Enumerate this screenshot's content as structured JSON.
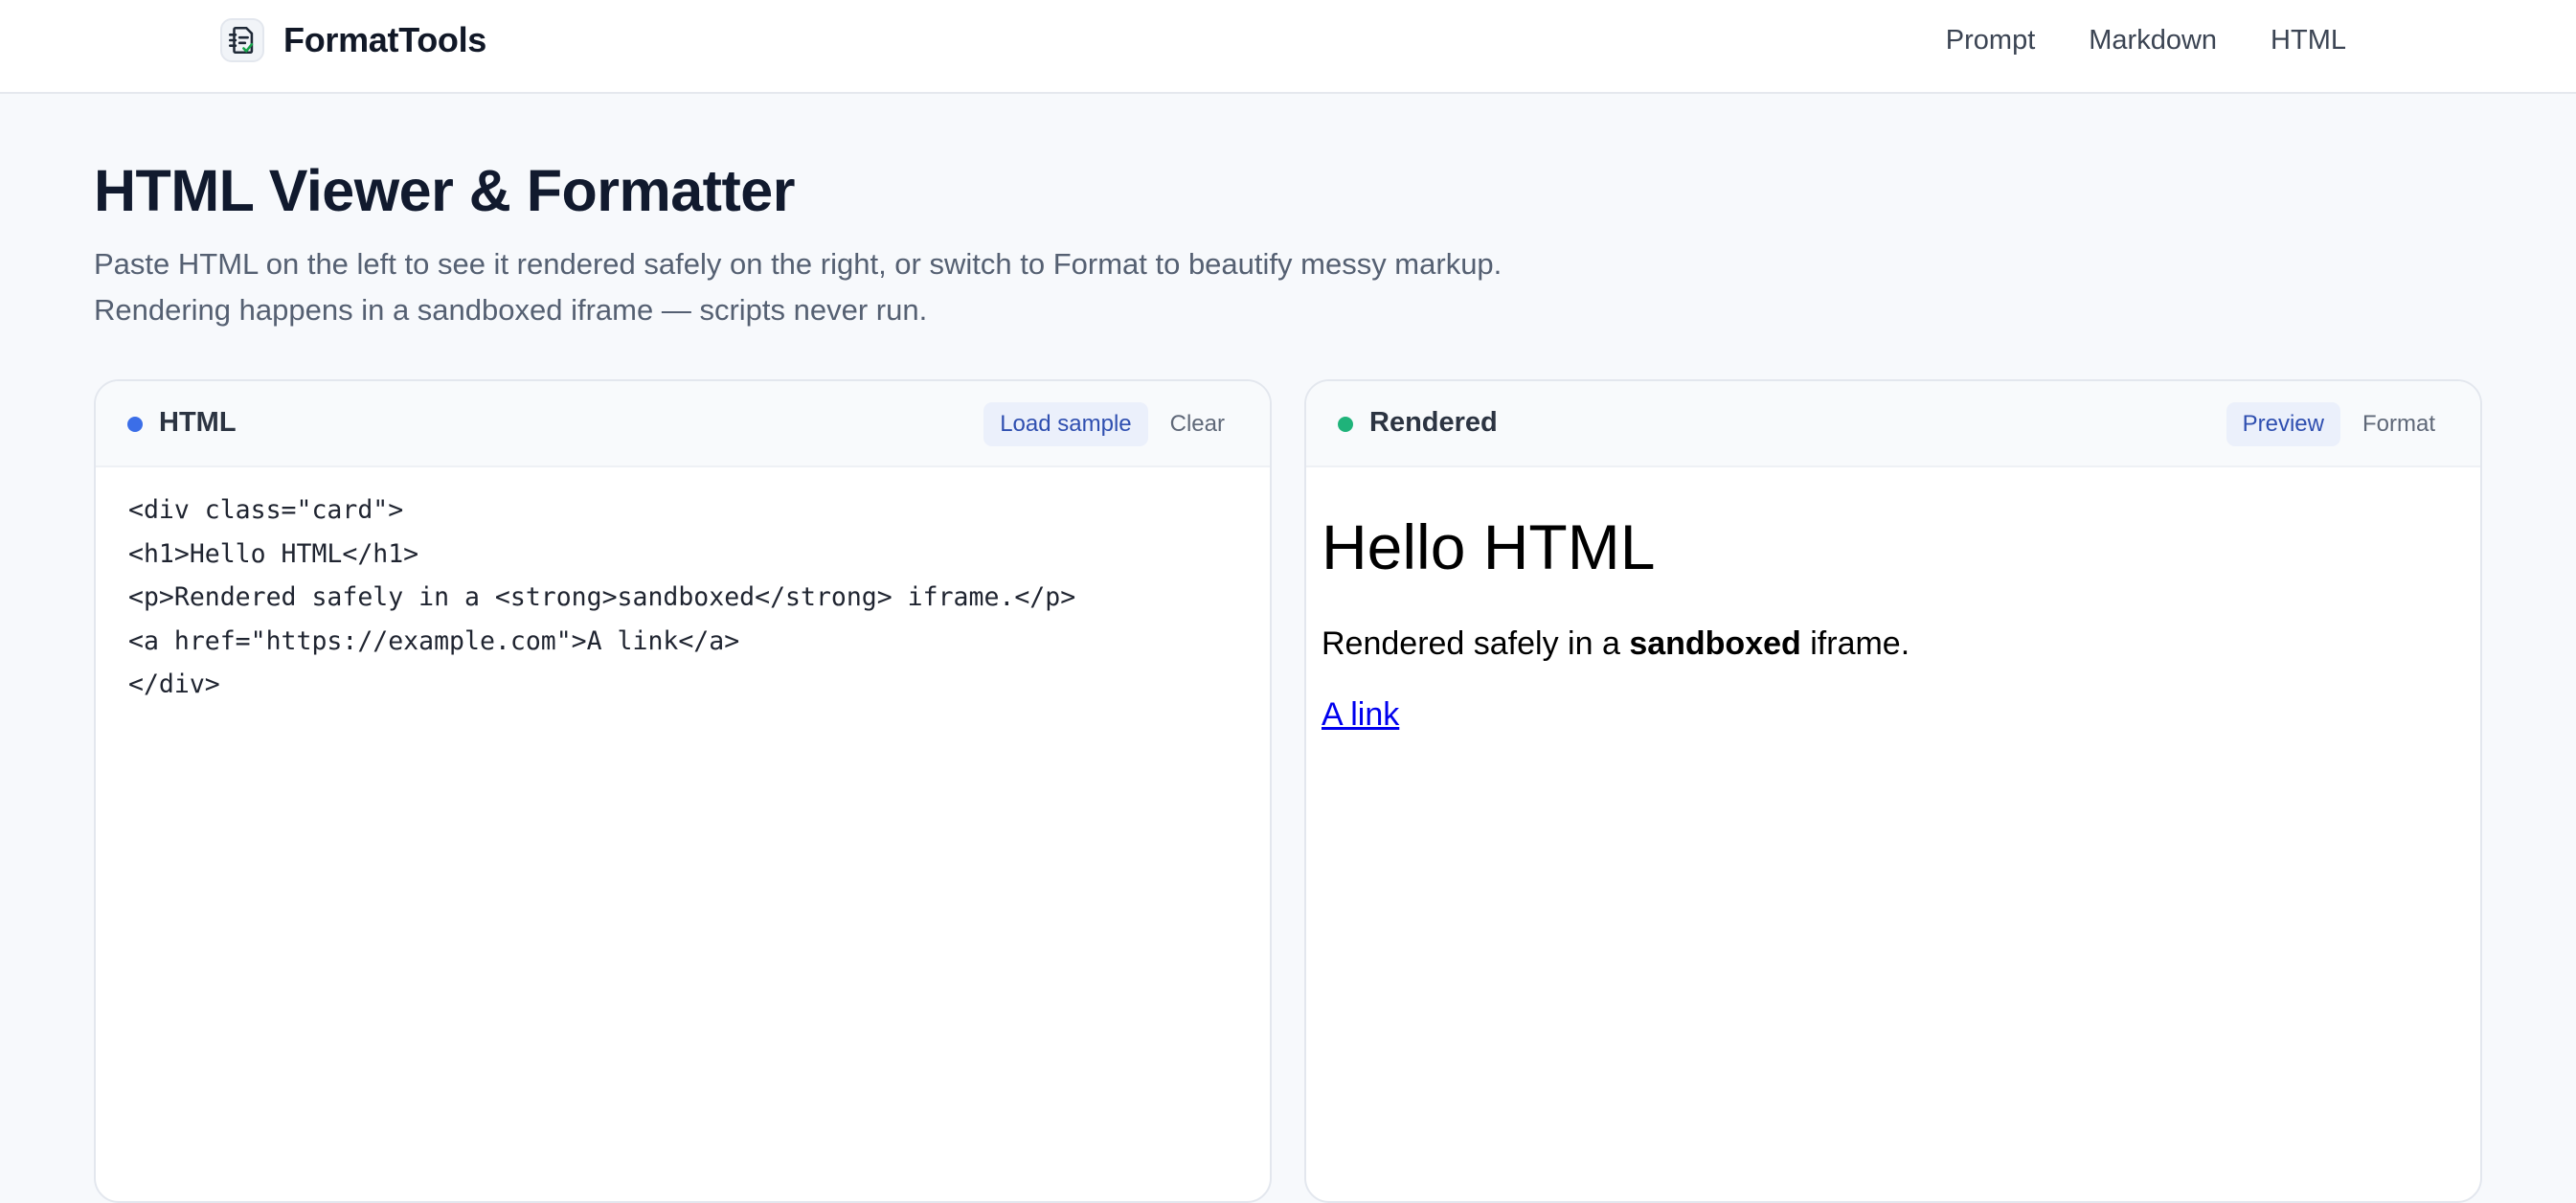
{
  "header": {
    "brand": "FormatTools",
    "logo_icon": "formatter-logo-icon",
    "nav": [
      "Prompt",
      "Markdown",
      "HTML"
    ]
  },
  "hero": {
    "title": "HTML Viewer & Formatter",
    "subtitle": "Paste HTML on the left to see it rendered safely on the right, or switch to Format to beautify messy markup. Rendering happens in a sandboxed iframe — scripts never run."
  },
  "input_panel": {
    "title": "HTML",
    "dot_color": "#3b6ee8",
    "buttons": {
      "load_sample": "Load sample",
      "clear": "Clear"
    },
    "code_lines": [
      "<div class=\"card\">",
      "<h1>Hello HTML</h1>",
      "<p>Rendered safely in a <strong>sandboxed</strong> iframe.</p>",
      "<a href=\"https://example.com\">A link</a>",
      "</div>"
    ]
  },
  "output_panel": {
    "title": "Rendered",
    "dot_color": "#1fb37a",
    "tabs": {
      "preview": "Preview",
      "format": "Format"
    },
    "active_tab": "Preview",
    "preview": {
      "heading": "Hello HTML",
      "text_before": "Rendered safely in a ",
      "text_strong": "sandboxed",
      "text_after": " iframe.",
      "link": "A link"
    }
  },
  "colors": {
    "accent": "#2f4fb0",
    "background": "#f7f9fc",
    "link": "#0000ee"
  }
}
